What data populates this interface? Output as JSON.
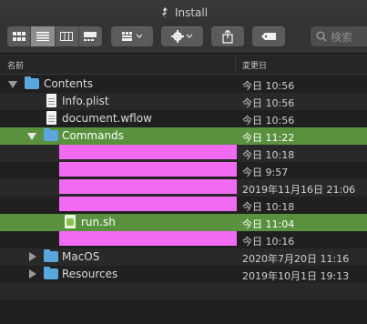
{
  "window": {
    "title": "Install"
  },
  "toolbar": {
    "view_modes": [
      "icon-view",
      "list-view",
      "column-view",
      "gallery-view"
    ],
    "active_view": 1,
    "group_icon": "grid-icon",
    "action_icon": "gear-icon",
    "share_icon": "share-icon",
    "tag_icon": "tag-icon",
    "search_placeholder": "検索"
  },
  "columns": {
    "name": "名前",
    "date": "変更日"
  },
  "rows": [
    {
      "name": "Contents",
      "date": "今日 10:56"
    },
    {
      "name": "Info.plist",
      "date": "今日 10:56"
    },
    {
      "name": "document.wflow",
      "date": "今日 10:56"
    },
    {
      "name": "Commands",
      "date": "今日 11:22"
    },
    {
      "name": "",
      "date": "今日 10:18"
    },
    {
      "name": "",
      "date": "今日 9:57"
    },
    {
      "name": "",
      "date": "2019年11月16日 21:06"
    },
    {
      "name": "",
      "date": "今日 10:18"
    },
    {
      "name": "run.sh",
      "date": "今日 11:04"
    },
    {
      "name": "",
      "date": "今日 10:16"
    },
    {
      "name": "MacOS",
      "date": "2020年7月20日 11:16"
    },
    {
      "name": "Resources",
      "date": "2019年10月1日 19:13"
    }
  ],
  "colors": {
    "selection": "#5a913f",
    "folder": "#5aa7dd",
    "redaction": "#f16af1"
  }
}
